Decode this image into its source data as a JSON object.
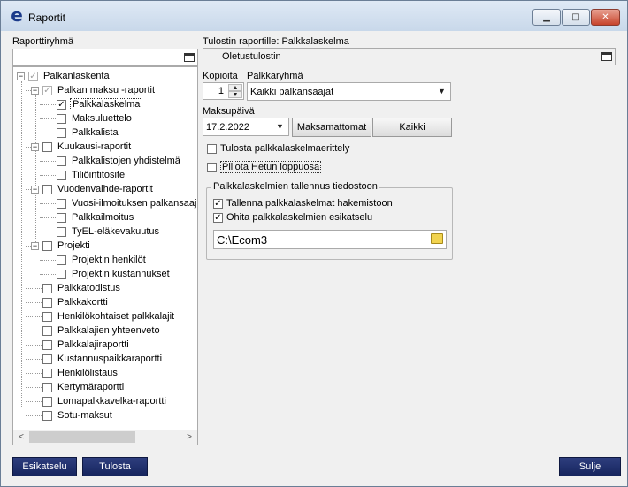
{
  "window": {
    "title": "Raportit",
    "minimize_glyph": "▁",
    "maximize_glyph": "□",
    "close_glyph": "✕"
  },
  "left": {
    "group_label": "Raporttiryhmä",
    "group_value": "",
    "tree": [
      {
        "label": "Palkanlaskenta",
        "expander": "−",
        "checked": "✓",
        "grey": true
      },
      {
        "label": "Palkan maksu -raportit",
        "expander": "−",
        "checked": "✓",
        "grey": true
      },
      {
        "label": "Palkkalaskelma",
        "checked": "✓",
        "selected": true
      },
      {
        "label": "Maksuluettelo",
        "checked": ""
      },
      {
        "label": "Palkkalista",
        "checked": ""
      },
      {
        "label": "Kuukausi-raportit",
        "expander": "−",
        "checked": ""
      },
      {
        "label": "Palkkalistojen yhdistelmä",
        "checked": ""
      },
      {
        "label": "Tiliöintitosite",
        "checked": ""
      },
      {
        "label": "Vuodenvaihde-raportit",
        "expander": "−",
        "checked": ""
      },
      {
        "label": "Vuosi-ilmoituksen palkansaajat",
        "checked": ""
      },
      {
        "label": "Palkkailmoitus",
        "checked": ""
      },
      {
        "label": "TyEL-eläkevakuutus",
        "checked": ""
      },
      {
        "label": "Projekti",
        "expander": "−",
        "checked": ""
      },
      {
        "label": "Projektin henkilöt",
        "checked": ""
      },
      {
        "label": "Projektin kustannukset",
        "checked": ""
      },
      {
        "label": "Palkkatodistus",
        "checked": ""
      },
      {
        "label": "Palkkakortti",
        "checked": ""
      },
      {
        "label": "Henkilökohtaiset palkkalajit",
        "checked": ""
      },
      {
        "label": "Palkkalajien yhteenveto",
        "checked": ""
      },
      {
        "label": "Palkkalajiraportti",
        "checked": ""
      },
      {
        "label": "Kustannuspaikkaraportti",
        "checked": ""
      },
      {
        "label": "Henkilölistaus",
        "checked": ""
      },
      {
        "label": "Kertymäraportti",
        "checked": ""
      },
      {
        "label": "Lomapalkkavelka-raportti",
        "checked": ""
      },
      {
        "label": "Sotu-maksut",
        "checked": ""
      }
    ],
    "scroll_left": "<",
    "scroll_right": ">"
  },
  "right": {
    "printer_label": "Tulostin raportille: Palkkalaskelma",
    "printer_value": "Oletustulostin",
    "copies_label": "Kopioita",
    "copies_value": "1",
    "paygroup_label": "Palkkaryhmä",
    "paygroup_value": "Kaikki palkansaajat",
    "paydate_label": "Maksupäivä",
    "paydate_value": "17.2.2022",
    "unpaid_button": "Maksamattomat",
    "all_button": "Kaikki",
    "print_spec_label": "Tulosta palkkalaskelmaerittely",
    "print_spec_checked": "",
    "hide_hetu_label": "Piilota Hetun loppuosa",
    "hide_hetu_checked": "",
    "save_group_title": "Palkkalaskelmien tallennus tiedostoon",
    "save_to_dir_label": "Tallenna palkkalaskelmat hakemistoon",
    "save_to_dir_checked": "✓",
    "skip_preview_label": "Ohita palkkalaskelmien esikatselu",
    "skip_preview_checked": "✓",
    "path_value": "C:\\Ecom3"
  },
  "footer": {
    "preview_button": "Esikatselu",
    "print_button": "Tulosta",
    "close_button": "Sulje"
  },
  "colors": {
    "accent_button": "#1f2f6e",
    "title_bar": "#d6e3f1",
    "close_button": "#c7432b"
  }
}
